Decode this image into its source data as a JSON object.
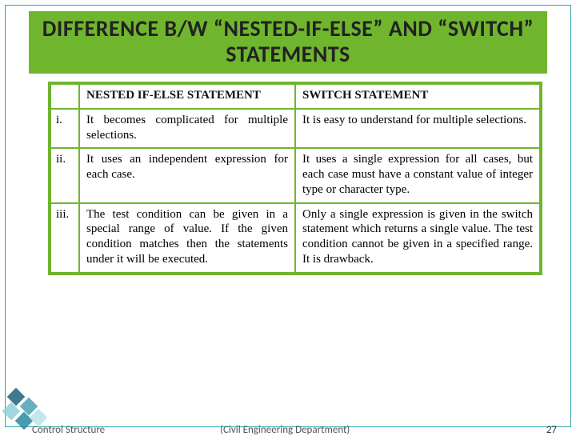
{
  "title": "DIFFERENCE B/W “NESTED-IF-ELSE” AND “SWITCH” STATEMENTS",
  "table": {
    "headers": {
      "blank": "",
      "col1": "NESTED IF-ELSE STATEMENT",
      "col2": "SWITCH STATEMENT"
    },
    "rows": [
      {
        "idx": "i.",
        "c1": "It becomes complicated for multiple selections.",
        "c2": "It is easy to understand for multiple selections."
      },
      {
        "idx": "ii.",
        "c1": "It uses an independent expression for each case.",
        "c2": "It uses a single expression for all cases, but each case must have a constant value of integer type or character type."
      },
      {
        "idx": "iii.",
        "c1": "The test condition can be given in a special range of value. If the given condition matches then the statements under it will be executed.",
        "c2": "Only a single expression is given in the switch statement which returns a single value. The test condition cannot be given in a specified range. It is drawback."
      }
    ]
  },
  "footer": {
    "left": "Control Structure",
    "mid": "(Civil Engineering Department)",
    "page": "27"
  }
}
